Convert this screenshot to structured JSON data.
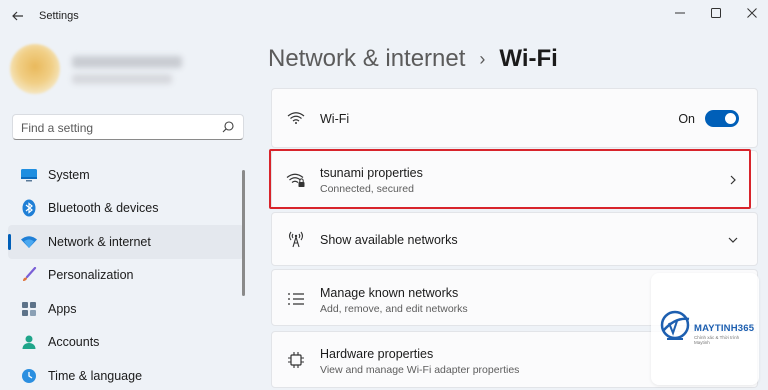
{
  "app": {
    "title": "Settings"
  },
  "search": {
    "placeholder": "Find a setting"
  },
  "sidebar": {
    "items": [
      {
        "label": "System",
        "icon": "monitor-icon"
      },
      {
        "label": "Bluetooth & devices",
        "icon": "bluetooth-icon"
      },
      {
        "label": "Network & internet",
        "icon": "wifi-icon",
        "active": true
      },
      {
        "label": "Personalization",
        "icon": "brush-icon"
      },
      {
        "label": "Apps",
        "icon": "apps-grid-icon"
      },
      {
        "label": "Accounts",
        "icon": "person-icon"
      },
      {
        "label": "Time & language",
        "icon": "globe-clock-icon"
      }
    ]
  },
  "breadcrumb": {
    "parent": "Network & internet",
    "separator": "›",
    "current": "Wi-Fi"
  },
  "wifi_toggle": {
    "label": "Wi-Fi",
    "state_text": "On",
    "on": true
  },
  "connection": {
    "title": "tsunami properties",
    "subtitle": "Connected, secured"
  },
  "available": {
    "title": "Show available networks"
  },
  "known": {
    "title": "Manage known networks",
    "subtitle": "Add, remove, and edit networks"
  },
  "hardware": {
    "title": "Hardware properties",
    "subtitle": "View and manage Wi-Fi adapter properties"
  },
  "watermark": {
    "brand": "MAYTINH365",
    "tagline": "Chính xác & Thời trình Maytinh"
  },
  "colors": {
    "accent": "#005fb8",
    "highlight_border": "#d8242b",
    "background": "#eef2f7"
  }
}
